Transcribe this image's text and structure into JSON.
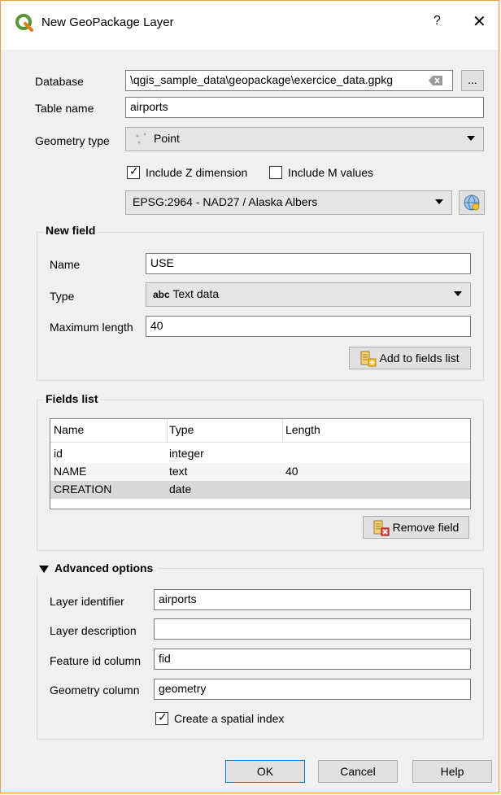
{
  "window": {
    "title": "New GeoPackage Layer",
    "help": "?",
    "close": "✕"
  },
  "form": {
    "database_label": "Database",
    "database_value": "\\qgis_sample_data\\geopackage\\exercice_data.gpkg",
    "browse_label": "...",
    "table_name_label": "Table name",
    "table_name_value": "airports",
    "geometry_type_label": "Geometry type",
    "geometry_type_value": "Point",
    "include_z_label": "Include Z dimension",
    "include_z_checked": true,
    "include_m_label": "Include M values",
    "include_m_checked": false,
    "crs_value": "EPSG:2964 - NAD27 / Alaska Albers"
  },
  "new_field": {
    "title": "New field",
    "name_label": "Name",
    "name_value": "USE",
    "type_label": "Type",
    "type_prefix": "abc",
    "type_value": "Text data",
    "maxlen_label": "Maximum length",
    "maxlen_value": "40",
    "add_button": "Add to fields list"
  },
  "fields_list": {
    "title": "Fields list",
    "columns": [
      "Name",
      "Type",
      "Length"
    ],
    "rows": [
      {
        "name": "id",
        "type": "integer",
        "length": ""
      },
      {
        "name": "NAME",
        "type": "text",
        "length": "40"
      },
      {
        "name": "CREATION",
        "type": "date",
        "length": ""
      }
    ],
    "remove_button": "Remove field"
  },
  "advanced": {
    "title": "Advanced options",
    "layer_identifier_label": "Layer identifier",
    "layer_identifier_value": "airports",
    "layer_description_label": "Layer description",
    "layer_description_value": "",
    "feature_id_label": "Feature id column",
    "feature_id_value": "fid",
    "geometry_column_label": "Geometry column",
    "geometry_column_value": "geometry",
    "spatial_index_label": "Create a spatial index",
    "spatial_index_checked": true
  },
  "buttons": {
    "ok": "OK",
    "cancel": "Cancel",
    "help": "Help"
  },
  "colors": {
    "qgis_green": "#589632",
    "focus_blue": "#0078d7"
  }
}
